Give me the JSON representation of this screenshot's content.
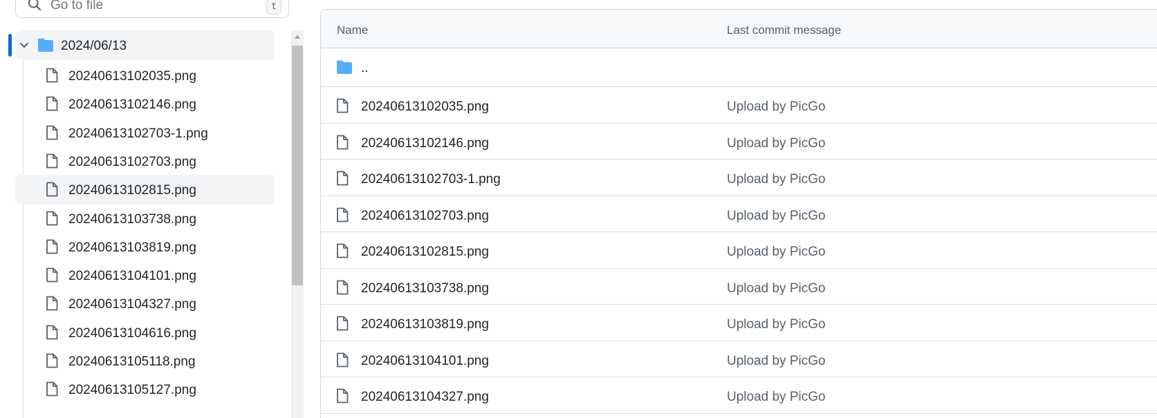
{
  "search": {
    "placeholder": "Go to file",
    "shortcut": "t"
  },
  "sidebar": {
    "folder": {
      "label": "2024/06/13",
      "expanded": true,
      "icon": "folder-icon"
    },
    "items": [
      {
        "label": "20240613102035.png"
      },
      {
        "label": "20240613102146.png"
      },
      {
        "label": "20240613102703-1.png"
      },
      {
        "label": "20240613102703.png"
      },
      {
        "label": "20240613102815.png"
      },
      {
        "label": "20240613103738.png"
      },
      {
        "label": "20240613103819.png"
      },
      {
        "label": "20240613104101.png"
      },
      {
        "label": "20240613104327.png"
      },
      {
        "label": "20240613104616.png"
      },
      {
        "label": "20240613105118.png"
      },
      {
        "label": "20240613105127.png"
      }
    ]
  },
  "table": {
    "columns": {
      "name": "Name",
      "message": "Last commit message"
    },
    "parent_label": "..",
    "rows": [
      {
        "name": "20240613102035.png",
        "message": "Upload by PicGo"
      },
      {
        "name": "20240613102146.png",
        "message": "Upload by PicGo"
      },
      {
        "name": "20240613102703-1.png",
        "message": "Upload by PicGo"
      },
      {
        "name": "20240613102703.png",
        "message": "Upload by PicGo"
      },
      {
        "name": "20240613102815.png",
        "message": "Upload by PicGo"
      },
      {
        "name": "20240613103738.png",
        "message": "Upload by PicGo"
      },
      {
        "name": "20240613103819.png",
        "message": "Upload by PicGo"
      },
      {
        "name": "20240613104101.png",
        "message": "Upload by PicGo"
      },
      {
        "name": "20240613104327.png",
        "message": "Upload by PicGo"
      }
    ]
  },
  "colors": {
    "accent": "#0969da",
    "folder": "#54aeff",
    "muted_text": "#57606a",
    "border": "#d0d7de"
  }
}
